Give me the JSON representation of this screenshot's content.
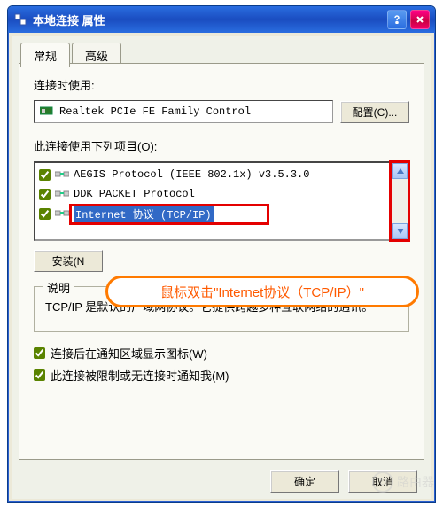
{
  "titlebar": {
    "title": "本地连接 属性"
  },
  "tabs": {
    "general": "常规",
    "advanced": "高级"
  },
  "panel": {
    "connect_label": "连接时使用:",
    "adapter_name": "Realtek PCIe FE Family Control",
    "configure_btn": "配置(C)...",
    "items_label": "此连接使用下列项目(O):",
    "items": [
      {
        "label": "AEGIS Protocol (IEEE 802.1x) v3.5.3.0",
        "checked": true,
        "selected": false
      },
      {
        "label": "DDK PACKET Protocol",
        "checked": true,
        "selected": false
      },
      {
        "label": "Internet 协议 (TCP/IP)",
        "checked": true,
        "selected": true
      }
    ],
    "install_btn": "安装(N",
    "desc_legend": "说明",
    "desc_text": "TCP/IP 是默认的广域网协议。它提供跨越多种互联网络的通讯。",
    "chk1": "连接后在通知区域显示图标(W)",
    "chk2": "此连接被限制或无连接时通知我(M)"
  },
  "footer": {
    "ok": "确定",
    "cancel": "取消"
  },
  "callout": {
    "text": "鼠标双击\"Internet协议（TCP/IP）\""
  },
  "watermark": {
    "text": "路由器"
  }
}
